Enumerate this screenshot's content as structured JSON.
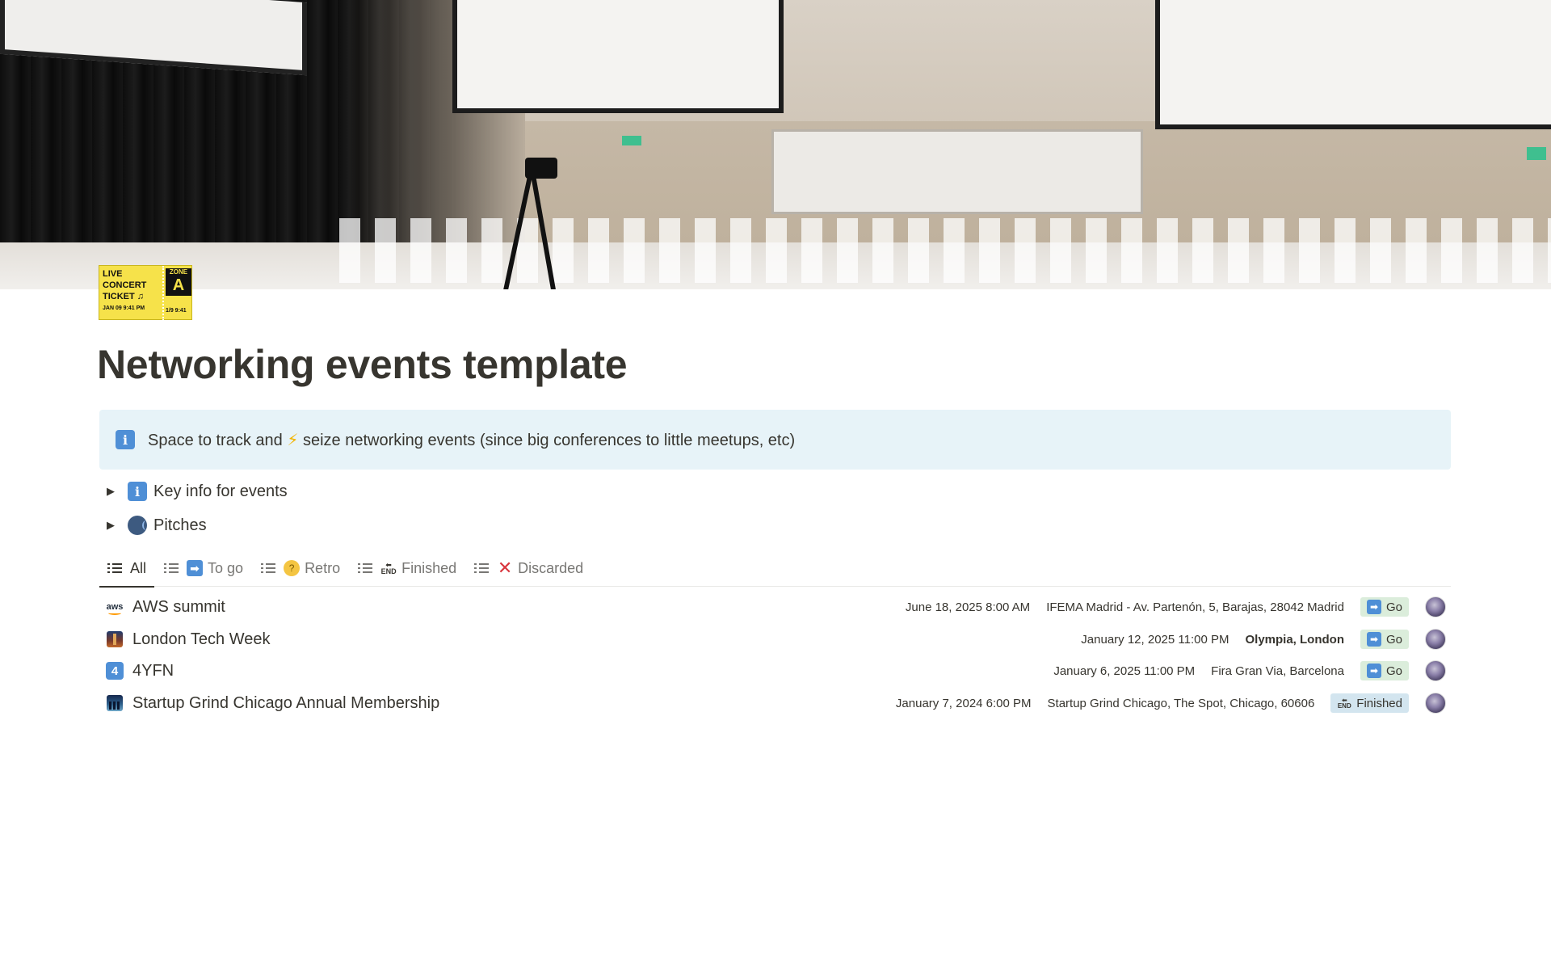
{
  "page": {
    "title": "Networking events template",
    "icon": "live-concert-ticket-icon",
    "cover": "conference-hall-photo"
  },
  "ticket": {
    "line1": "LIVE",
    "line2": "CONCERT",
    "line3": "TICKET ♫",
    "datetime": "JAN 09   9:41 PM",
    "zone_label": "ZONE",
    "zone_value": "A",
    "zone_datetime": "1/9   9:41"
  },
  "callout": {
    "icon": "information-icon",
    "icon_glyph": "i",
    "text_before": "Space to track and",
    "bolt": "⚡",
    "text_after": "seize networking events (since big conferences to little meetups, etc)"
  },
  "toggles": [
    {
      "icon": "information-icon",
      "icon_glyph": "i",
      "label": "Key info for events"
    },
    {
      "icon": "speaking-head-icon",
      "label": "Pitches"
    }
  ],
  "tabs": [
    {
      "label": "All",
      "active": true
    },
    {
      "label": "To go",
      "emoji": "➡"
    },
    {
      "label": "Retro",
      "emoji": "🤔"
    },
    {
      "label": "Finished",
      "emoji": "🔚",
      "emoji_top": "⬅",
      "emoji_bottom": "END"
    },
    {
      "label": "Discarded",
      "emoji": "✕"
    }
  ],
  "rows": [
    {
      "icon": "aws-logo-icon",
      "icon_text": "aws",
      "title": "AWS summit",
      "date": "June 18, 2025 8:00 AM",
      "location": "IFEMA Madrid - Av. Partenón, 5, Barajas, 28042 Madrid",
      "status": "Go",
      "status_emoji": "➡"
    },
    {
      "icon": "london-bridge-icon",
      "title": "London Tech Week",
      "date": "January 12, 2025 11:00 PM",
      "location": "Olympia, London",
      "status": "Go",
      "status_emoji": "➡"
    },
    {
      "icon": "keycap-four-icon",
      "icon_text": "4",
      "title": "4YFN",
      "date": "January 6, 2025 11:00 PM",
      "location": "Fira Gran Via, Barcelona",
      "status": "Go",
      "status_emoji": "➡"
    },
    {
      "icon": "city-skyline-icon",
      "title": "Startup Grind Chicago Annual Membership",
      "date": "January 7, 2024 6:00 PM",
      "location": "Startup Grind Chicago, The Spot, Chicago, 60606",
      "status": "Finished",
      "status_emoji_top": "⬅",
      "status_emoji_bottom": "END"
    }
  ],
  "colors": {
    "callout_bg": "#e7f3f8",
    "status_go_bg": "#dbeddb",
    "status_finished_bg": "#d3e5ef",
    "text": "#37352f",
    "muted": "#787774"
  }
}
